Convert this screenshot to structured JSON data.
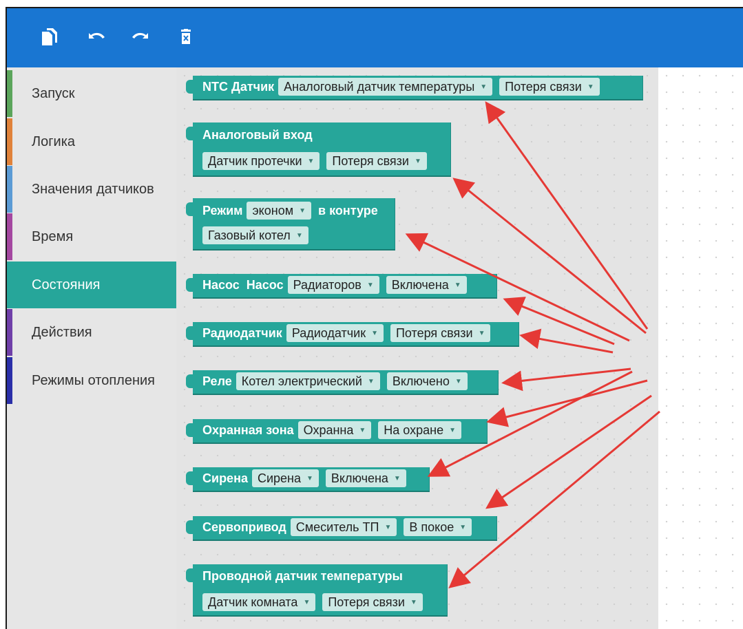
{
  "toolbar": {
    "copy_icon": "copy-icon",
    "undo_icon": "undo-icon",
    "redo_icon": "redo-icon",
    "delete_icon": "delete-icon",
    "background": "#1976d2"
  },
  "sidebar": {
    "items": [
      {
        "label": "Запуск",
        "color": "#5ba55b"
      },
      {
        "label": "Логика",
        "color": "#e0823a"
      },
      {
        "label": "Значения датчиков",
        "color": "#5b9bd5"
      },
      {
        "label": "Время",
        "color": "#a447a0"
      },
      {
        "label": "Состояния",
        "color": "#26a69a",
        "selected": true
      },
      {
        "label": "Действия",
        "color": "#6f3fa8"
      },
      {
        "label": "Режимы отопления",
        "color": "#2a2fa8"
      }
    ]
  },
  "blocks": [
    {
      "title": "NTC Датчик",
      "dd1": "Аналоговый датчик температуры",
      "dd2": "Потеря связи"
    },
    {
      "title": "Аналоговый вход",
      "dd1": "Датчик протечки",
      "dd2": "Потеря связи"
    },
    {
      "title": "Режим",
      "dd1": "эконом",
      "title2": "в контуре",
      "dd2": "Газовый котел"
    },
    {
      "title": "Насос  Насос",
      "dd1": "Радиаторов",
      "dd2": "Включена"
    },
    {
      "title": "Радиодатчик",
      "dd1": "Радиодатчик",
      "dd2": "Потеря связи"
    },
    {
      "title": "Реле",
      "dd1": "Котел электрический",
      "dd2": "Включено"
    },
    {
      "title": "Охранная зона",
      "dd1": "Охранна",
      "dd2": "На охране"
    },
    {
      "title": "Сирена",
      "dd1": "Сирена",
      "dd2": "Включена"
    },
    {
      "title": "Сервопривод",
      "dd1": "Смеситель ТП",
      "dd2": "В покое"
    },
    {
      "title": "Проводной датчик температуры",
      "dd1": "Датчик комната",
      "dd2": "Потеря связи"
    }
  ],
  "colors": {
    "block": "#26a69a",
    "dropdown": "#cde9e5",
    "arrow": "#e53935"
  }
}
